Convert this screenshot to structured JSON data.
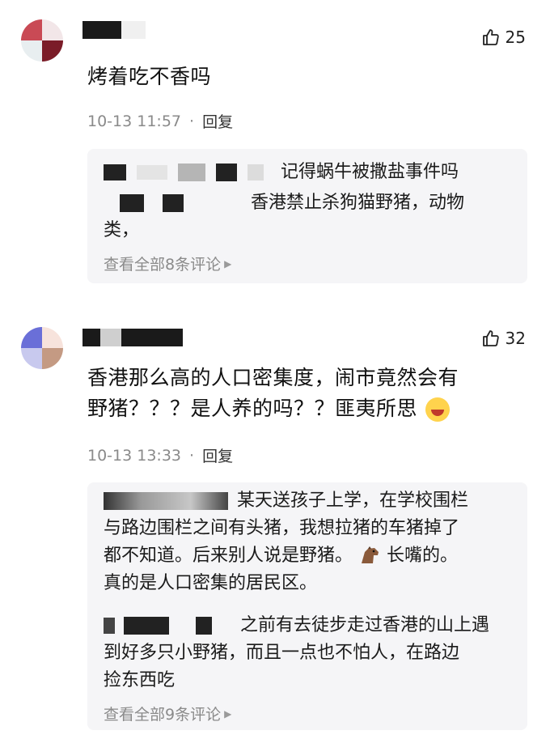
{
  "comments": [
    {
      "likes": "25",
      "text": "烤着吃不香吗",
      "time": "10-13 11:57",
      "separator": "·",
      "reply_label": "回复",
      "replies": [
        {
          "text_a": "记得蜗牛被撒盐事件吗",
          "text_b": "香港禁止杀狗猫野猪，动物",
          "text_c": "类，"
        }
      ],
      "view_all": "查看全部8条评论"
    },
    {
      "likes": "32",
      "text_line1": "香港那么高的人口密集度，闹市竟然会有",
      "text_line2": "野猪？？？是人养的吗？？匪夷所思",
      "laugh_emoji": "crying-laughing-emoji",
      "time": "10-13 13:33",
      "separator": "·",
      "reply_label": "回复",
      "replies": [
        {
          "line1": "某天送孩子上学，在学校围栏",
          "line2": "与路边围栏之间有头猪，我想拉猪的车猪掉了",
          "line3a": "都不知道。后来别人说是野猪。",
          "horse_emoji": "horse-emoji",
          "line3b": "长嘴的。",
          "line4": "真的是人口密集的居民区。"
        },
        {
          "line1": "之前有去徒步走过香港的山上遇",
          "line2": "到好多只小野猪，而且一点也不怕人，在路边",
          "line3": "捡东西吃"
        }
      ],
      "view_all": "查看全部9条评论"
    }
  ],
  "icons": {
    "like": "thumbs-up-icon",
    "arrow": "chevron-right-icon"
  },
  "colors": {
    "meta_gray": "#8a8a8a",
    "reply_bg": "#f5f5f7"
  }
}
